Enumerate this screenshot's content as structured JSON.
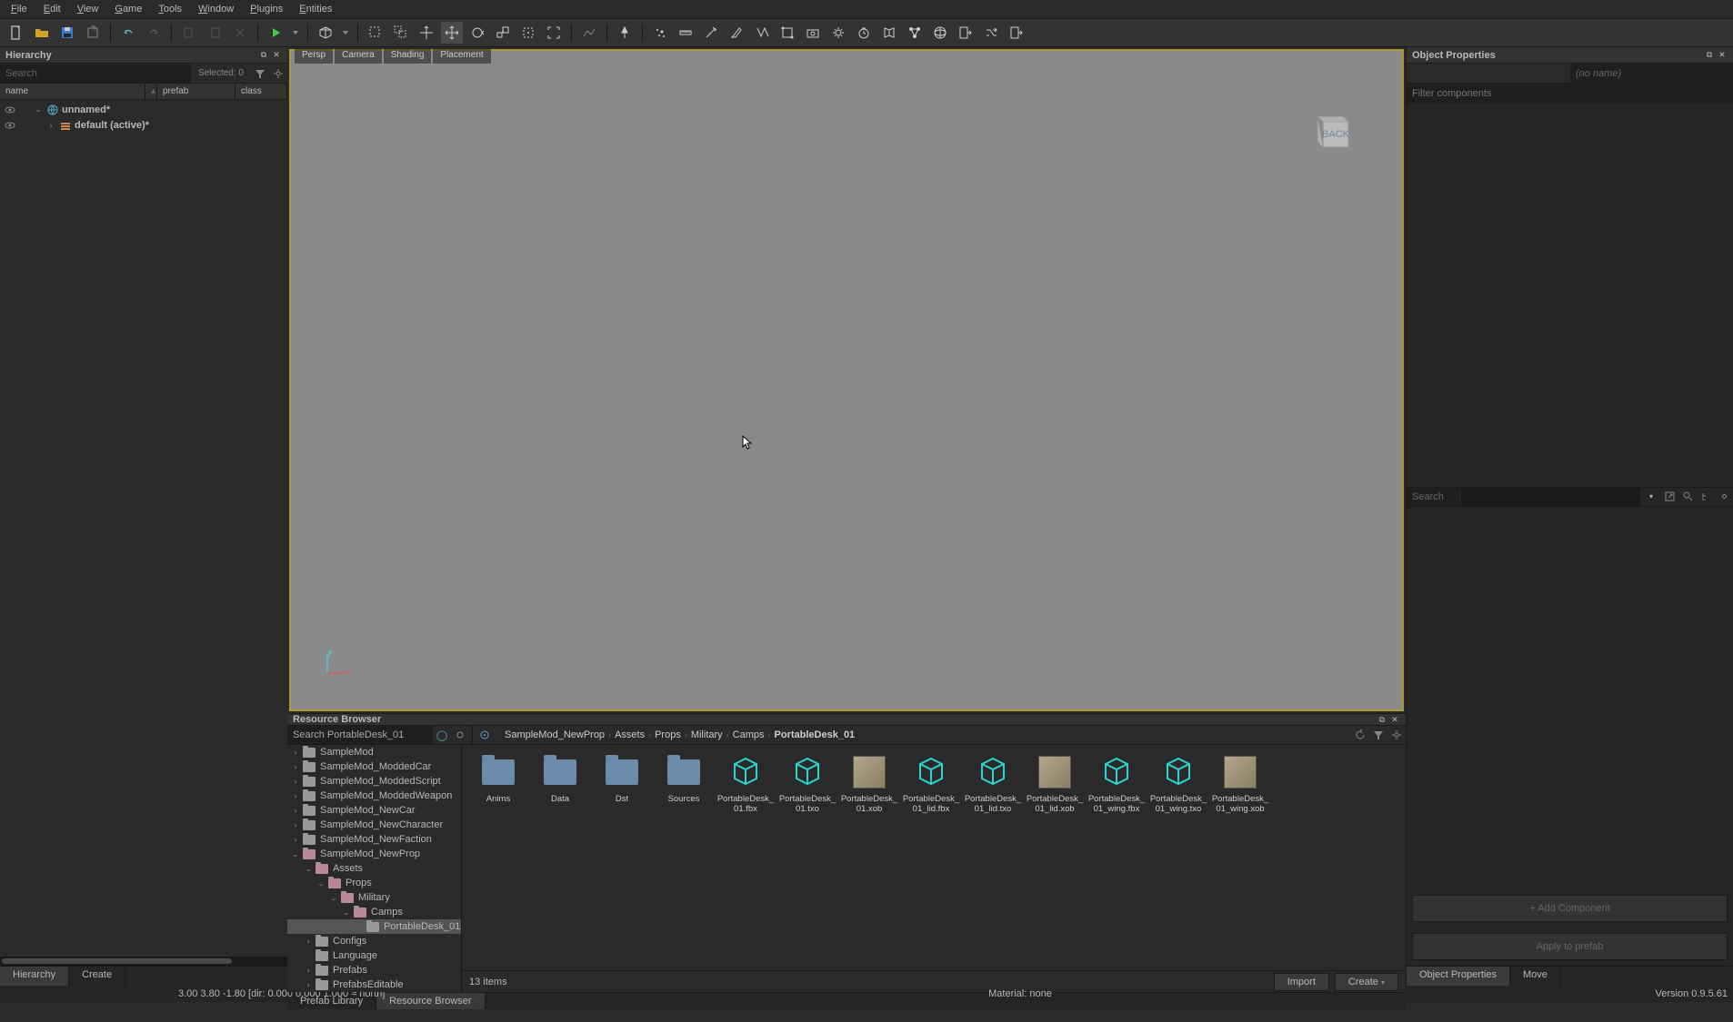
{
  "menu": {
    "items": [
      "File",
      "Edit",
      "View",
      "Game",
      "Tools",
      "Window",
      "Plugins",
      "Entities"
    ]
  },
  "hierarchy": {
    "title": "Hierarchy",
    "search_ph": "Search",
    "selected": "Selected: 0",
    "cols": [
      "name",
      "prefab",
      "class"
    ],
    "rows": [
      {
        "label": "unnamed*",
        "indent": 0,
        "icon": "world"
      },
      {
        "label": "default (active)*",
        "indent": 1,
        "icon": "layer"
      }
    ]
  },
  "viewport": {
    "tabs": [
      "Persp",
      "Camera",
      "Shading",
      "Placement"
    ]
  },
  "resource": {
    "title": "Resource Browser",
    "search_val": "Search PortableDesk_01",
    "breadcrumb": [
      "SampleMod_NewProp",
      "Assets",
      "Props",
      "Military",
      "Camps",
      "PortableDesk_01"
    ],
    "tree": [
      {
        "l": "SampleMod",
        "d": 0,
        "e": "›"
      },
      {
        "l": "SampleMod_ModdedCar",
        "d": 0,
        "e": "›"
      },
      {
        "l": "SampleMod_ModdedScript",
        "d": 0,
        "e": "›"
      },
      {
        "l": "SampleMod_ModdedWeapon",
        "d": 0,
        "e": "›"
      },
      {
        "l": "SampleMod_NewCar",
        "d": 0,
        "e": "›"
      },
      {
        "l": "SampleMod_NewCharacter",
        "d": 0,
        "e": "›"
      },
      {
        "l": "SampleMod_NewFaction",
        "d": 0,
        "e": "›"
      },
      {
        "l": "SampleMod_NewProp",
        "d": 0,
        "e": "⌄",
        "open": true
      },
      {
        "l": "Assets",
        "d": 1,
        "e": "⌄",
        "open": true
      },
      {
        "l": "Props",
        "d": 2,
        "e": "⌄",
        "open": true
      },
      {
        "l": "Military",
        "d": 3,
        "e": "⌄",
        "open": true
      },
      {
        "l": "Camps",
        "d": 4,
        "e": "⌄",
        "open": true
      },
      {
        "l": "PortableDesk_01",
        "d": 5,
        "e": "",
        "sel": true
      },
      {
        "l": "Configs",
        "d": 1,
        "e": "›"
      },
      {
        "l": "Language",
        "d": 1,
        "e": ""
      },
      {
        "l": "Prefabs",
        "d": 1,
        "e": "›"
      },
      {
        "l": "PrefabsEditable",
        "d": 1,
        "e": "›"
      }
    ],
    "items": [
      {
        "name": "Anims",
        "type": "folder"
      },
      {
        "name": "Data",
        "type": "folder"
      },
      {
        "name": "Dst",
        "type": "folder"
      },
      {
        "name": "Sources",
        "type": "folder"
      },
      {
        "name": "PortableDesk_01.fbx",
        "type": "cube"
      },
      {
        "name": "PortableDesk_01.txo",
        "type": "cube"
      },
      {
        "name": "PortableDesk_01.xob",
        "type": "xob"
      },
      {
        "name": "PortableDesk_01_lid.fbx",
        "type": "cube"
      },
      {
        "name": "PortableDesk_01_lid.txo",
        "type": "cube"
      },
      {
        "name": "PortableDesk_01_lid.xob",
        "type": "xob"
      },
      {
        "name": "PortableDesk_01_wing.fbx",
        "type": "cube"
      },
      {
        "name": "PortableDesk_01_wing.txo",
        "type": "cube"
      },
      {
        "name": "PortableDesk_01_wing.xob",
        "type": "xob"
      }
    ],
    "count": "13 items",
    "import": "Import",
    "create": "Create"
  },
  "left_tabs": [
    "Hierarchy",
    "Create"
  ],
  "center_tabs": [
    "Prefab Library",
    "Resource Browser"
  ],
  "right_tabs": [
    "Object Properties",
    "Move"
  ],
  "props": {
    "title": "Object Properties",
    "noname": "(no name)",
    "filter_ph": "Filter components",
    "search_ph": "Search",
    "add": "+ Add Component",
    "apply": "Apply to prefab"
  },
  "status": {
    "coords": "3.00    3.80    -1.80 [dir: 0.000  0.000  1.000 ≈ north]",
    "material": "Material: none",
    "version": "Version 0.9.5.61"
  }
}
